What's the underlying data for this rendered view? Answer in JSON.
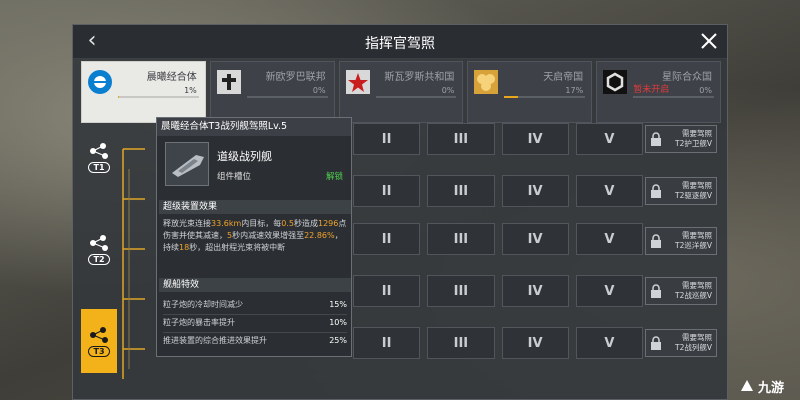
{
  "header": {
    "title": "指挥官驾照"
  },
  "factions": [
    {
      "name": "晨曦经合体",
      "pct": "1%",
      "progress": 0.01,
      "active": true,
      "locked_text": "",
      "icon": "dawn-orbit-icon"
    },
    {
      "name": "新欧罗巴联邦",
      "pct": "0%",
      "progress": 0,
      "active": false,
      "locked_text": "",
      "icon": "cross-emblem-icon"
    },
    {
      "name": "斯瓦罗斯共和国",
      "pct": "0%",
      "progress": 0,
      "active": false,
      "locked_text": "",
      "icon": "red-star-icon"
    },
    {
      "name": "天启帝国",
      "pct": "17%",
      "progress": 0.17,
      "active": false,
      "locked_text": "",
      "icon": "gold-coins-icon"
    },
    {
      "name": "星际合众国",
      "pct": "0%",
      "progress": 0,
      "active": false,
      "locked_text": "暂未开启",
      "icon": "hex-emblem-icon"
    }
  ],
  "tiers": [
    {
      "label": "T1"
    },
    {
      "label": "T2"
    },
    {
      "label": "T3"
    }
  ],
  "grid": {
    "column_numerals": [
      "II",
      "III",
      "IV",
      "V"
    ],
    "requirements": [
      {
        "line1": "需要驾照",
        "line2": "T2护卫舰V"
      },
      {
        "line1": "需要驾照",
        "line2": "T2驱逐舰V"
      },
      {
        "line1": "需要驾照",
        "line2": "T2巡洋舰V"
      },
      {
        "line1": "需要驾照",
        "line2": "T2战巡舰V"
      },
      {
        "line1": "需要驾照",
        "line2": "T2战列舰V"
      }
    ]
  },
  "tooltip": {
    "title": "晨曦经合体T3战列舰驾照Lv.5",
    "ship_name": "道级战列舰",
    "ship_sub": "组件槽位",
    "ship_status": "解锁",
    "section1": "超级装置效果",
    "desc_parts": {
      "p1": "释放光束连接",
      "v1": "33.6km",
      "p2": "内目标，每",
      "v2": "0.5",
      "p3": "秒造成",
      "v3": "1296",
      "p4": "点伤害并使其减速，",
      "v4": "5",
      "p5": "秒内减速效果增强至",
      "v5": "22.86%",
      "p6": "，持续",
      "v6": "18",
      "p7": "秒，超出射程光束将被中断"
    },
    "section2": "舰船特效",
    "effects": [
      {
        "label": "粒子炮的冷却时间减少",
        "value": "15%"
      },
      {
        "label": "粒子炮的暴击率提升",
        "value": "10%"
      },
      {
        "label": "推进装置的综合推进效果提升",
        "value": "25%"
      }
    ]
  },
  "watermark": {
    "text": "九游"
  },
  "colors": {
    "accent": "#f3b21a",
    "unlock": "#4fcc4f",
    "locked": "#e23a3a",
    "highlight": "#f0a32b"
  }
}
